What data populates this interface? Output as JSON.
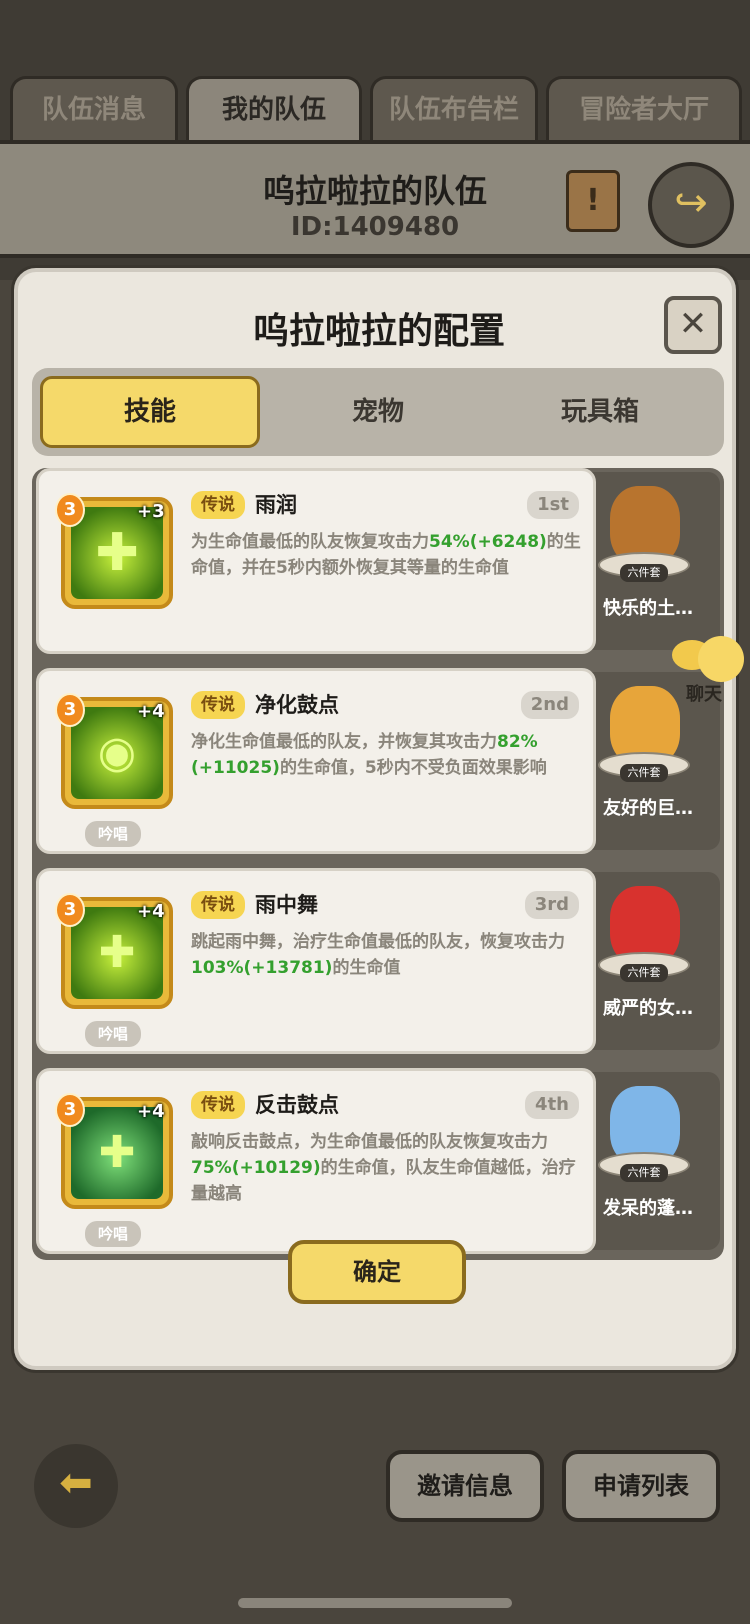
{
  "top_tabs": [
    "队伍消息",
    "我的队伍",
    "队伍布告栏",
    "冒险者大厅"
  ],
  "team": {
    "name": "呜拉啦拉的队伍",
    "id": "ID:1409480"
  },
  "dialog": {
    "title": "呜拉啦拉的配置",
    "close_label": "✕",
    "subtabs": [
      "技能",
      "宠物",
      "玩具箱"
    ],
    "active_subtab": "技能",
    "confirm_label": "确定"
  },
  "skills": [
    {
      "rarity": "传说",
      "name": "雨润",
      "rank": "1st",
      "level": "3",
      "plus": "+3",
      "chant": "",
      "desc_parts": [
        "为生命值最低的队友恢复攻击力",
        "54%(+6248)",
        "的生命值，并在5秒内额外恢复其等量的生命值"
      ],
      "pet_name": "快乐的土…",
      "pet_badge": "六件套"
    },
    {
      "rarity": "传说",
      "name": "净化鼓点",
      "rank": "2nd",
      "level": "3",
      "plus": "+4",
      "chant": "吟唱",
      "desc_parts": [
        "净化生命值最低的队友，并恢复其攻击力",
        "82%(+11025)",
        "的生命值，5秒内不受负面效果影响"
      ],
      "pet_name": "友好的巨…",
      "pet_badge": "六件套"
    },
    {
      "rarity": "传说",
      "name": "雨中舞",
      "rank": "3rd",
      "level": "3",
      "plus": "+4",
      "chant": "吟唱",
      "desc_parts": [
        "跳起雨中舞，治疗生命值最低的队友，恢复攻击力",
        "103%(+13781)",
        "的生命值"
      ],
      "pet_name": "威严的女…",
      "pet_badge": "六件套"
    },
    {
      "rarity": "传说",
      "name": "反击鼓点",
      "rank": "4th",
      "level": "3",
      "plus": "+4",
      "chant": "吟唱",
      "desc_parts": [
        "敲响反击鼓点，为生命值最低的队友恢复攻击力",
        "75%(+10129)",
        "的生命值，队友生命值越低，治疗量越高"
      ],
      "pet_name": "发呆的蓬…",
      "pet_badge": "六件套"
    }
  ],
  "chat_label": "聊天",
  "bottom": {
    "invite_label": "邀请信息",
    "apply_label": "申请列表"
  },
  "colors": {
    "accent_yellow": "#f5d96a",
    "highlight_green": "#34a02e",
    "pet_colors": [
      "#b8742e",
      "#e7a53a",
      "#d8322e",
      "#7fb6e8"
    ]
  }
}
